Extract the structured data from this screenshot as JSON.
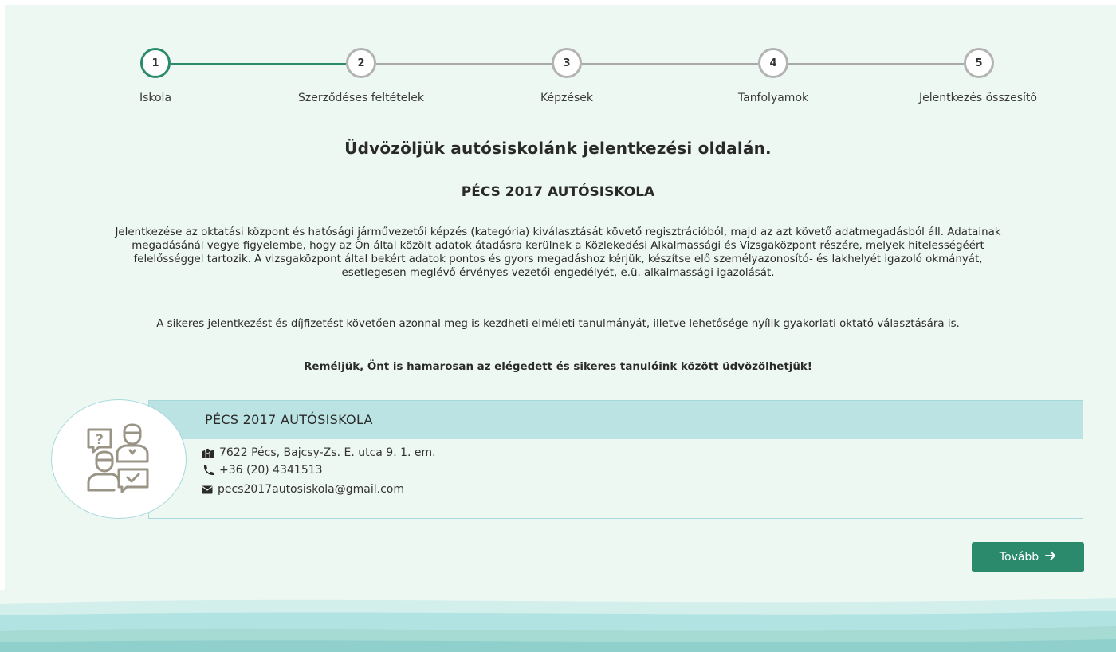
{
  "steps": [
    {
      "number": "1",
      "label": "Iskola",
      "active": true
    },
    {
      "number": "2",
      "label": "Szerződéses feltételek",
      "active": false
    },
    {
      "number": "3",
      "label": "Képzések",
      "active": false
    },
    {
      "number": "4",
      "label": "Tanfolyamok",
      "active": false
    },
    {
      "number": "5",
      "label": "Jelentkezés összesítő",
      "active": false
    }
  ],
  "intro": {
    "heading": "Üdvözöljük autósiskolánk jelentkezési oldalán.",
    "school_name": "PÉCS 2017 AUTÓSISKOLA",
    "paragraph1": "Jelentkezése az oktatási központ és hatósági járművezetői képzés (kategória) kiválasztását követő regisztrációból, majd az azt követő adatmegadásból áll. Adatainak megadásánál vegye figyelembe, hogy az Ön által közölt adatok átadásra kerülnek a Közlekedési Alkalmassági és Vizsgaközpont részére, melyek hitelességéért felelősséggel tartozik. A vizsgaközpont által bekért adatok pontos és gyors megadáshoz kérjük, készítse elő személyazonosító- és lakhelyét igazoló okmányát, esetlegesen meglévő érvényes vezetői engedélyét, e.ü. alkalmassági igazolását.",
    "paragraph2": "A sikeres jelentkezést és díjfizetést követően azonnal meg is kezdheti elméleti tanulmányát, illetve lehetősége nyílik gyakorlati oktató választására is.",
    "paragraph3": "Reméljük, Önt is hamarosan az elégedett és sikeres tanulóink között üdvözölhetjük!"
  },
  "school_card": {
    "title": "PÉCS 2017 AUTÓSISKOLA",
    "address": "7622 Pécs, Bajcsy-Zs. E. utca 9. 1. em.",
    "phone": "+36 (20) 4341513",
    "email": "pecs2017autosiskola@gmail.com",
    "icons": {
      "address": "map-icon",
      "phone": "phone-icon",
      "email": "envelope-icon",
      "avatar": "consultation-icon"
    }
  },
  "actions": {
    "next_label": "Tovább"
  },
  "colors": {
    "accent": "#2a8a6b",
    "inactive": "#b3b3b3",
    "panel_bg": "#eef8f3",
    "card_header": "#bce3e3",
    "icon_stroke": "#9a9486"
  }
}
